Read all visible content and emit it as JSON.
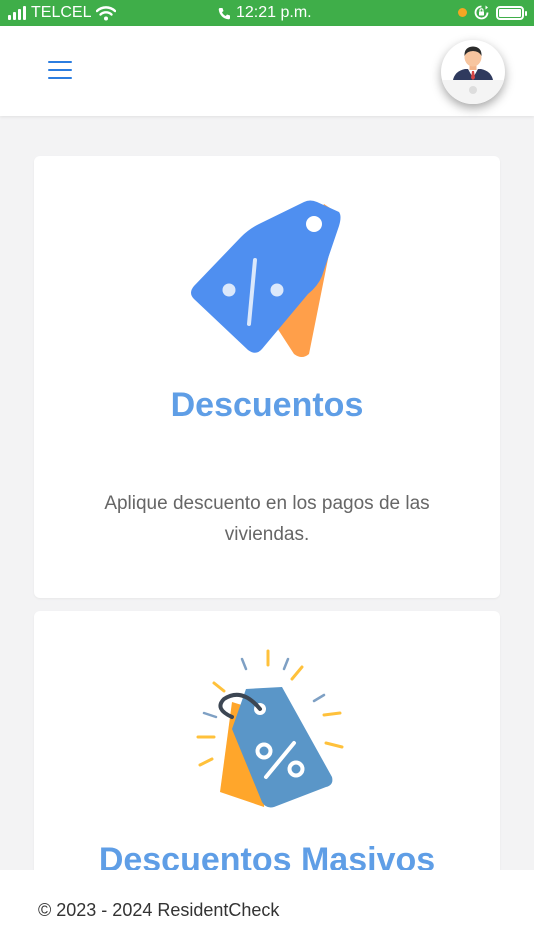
{
  "status_bar": {
    "carrier": "TELCEL",
    "time": "12:21 p.m.",
    "icons": [
      "signal-icon",
      "wifi-icon",
      "phone-icon",
      "orange-dot",
      "rotation-lock-icon",
      "battery-icon"
    ]
  },
  "header": {
    "menu_icon": "hamburger-menu-icon",
    "avatar_icon": "user-avatar-businessman"
  },
  "cards": [
    {
      "title": "Descuentos",
      "description": "Aplique descuento en los pagos de las viviendas.",
      "icon": "discount-tag-icon"
    },
    {
      "title": "Descuentos Masivos",
      "icon": "mass-discount-tags-icon"
    }
  ],
  "footer": {
    "text": "© 2023 - 2024 ResidentCheck"
  },
  "colors": {
    "status_bar": "#3fae49",
    "accent_blue": "#2b7de0",
    "title_blue": "#5f9ee6",
    "tag_blue": "#4f8ff0",
    "tag_orange": "#ffa04a"
  }
}
